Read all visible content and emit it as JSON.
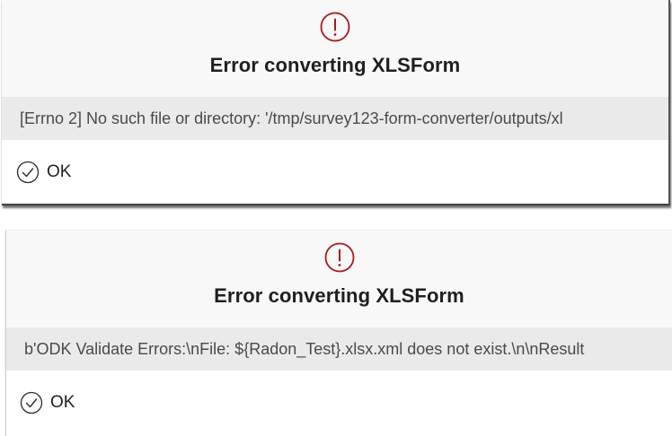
{
  "colors": {
    "error_accent": "#a8191b",
    "header_bg": "#f8f8f8",
    "message_bg": "#eaeaea"
  },
  "dialogs": [
    {
      "icon": "exclamation-circle-icon",
      "title": "Error converting XLSForm",
      "message": "[Errno 2] No such file or directory: '/tmp/survey123-form-converter/outputs/xl",
      "ok_icon": "check-circle-icon",
      "ok_label": "OK"
    },
    {
      "icon": "exclamation-circle-icon",
      "title": "Error converting XLSForm",
      "message": "b'ODK Validate Errors:\\nFile: ${Radon_Test}.xlsx.xml does not exist.\\n\\nResult",
      "ok_icon": "check-circle-icon",
      "ok_label": "OK"
    }
  ]
}
